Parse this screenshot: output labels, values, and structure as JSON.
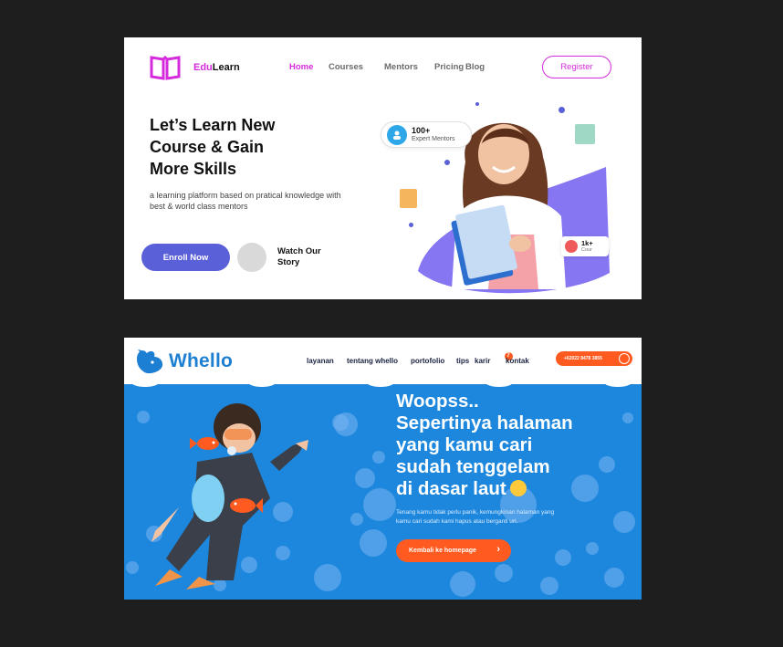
{
  "edulearn": {
    "brand": {
      "part1": "Edu",
      "part2": "Learn"
    },
    "nav": [
      "Home",
      "Courses",
      "Mentors",
      "Pricing",
      "Blog"
    ],
    "register_label": "Register",
    "headline": [
      "Let’s Learn New",
      "Course & Gain",
      "More Skills"
    ],
    "subtitle": [
      "a learning platform based on  pratical knowledge with",
      "best & world class mentors"
    ],
    "enroll_label": "Enroll Now",
    "watch_label": [
      "Watch Our",
      "Story"
    ],
    "mentors_badge": {
      "count": "100+",
      "label": "Expert Mentors"
    },
    "courses_badge": {
      "count": "1k+",
      "label": "Cour"
    },
    "colors": {
      "accent": "#d52bdc",
      "primary": "#5a60d8"
    }
  },
  "whello": {
    "brand": "Whello",
    "nav": [
      "layanan",
      "tentang whello",
      "portofolio",
      "tips",
      "karir",
      "kontak"
    ],
    "karir_badge": "7",
    "phone": "+62022 8478 3855",
    "headline": [
      "Woopss..",
      "Sepertinya halaman",
      "yang kamu cari",
      "sudah tenggelam",
      "di dasar laut"
    ],
    "subtitle": [
      "Tenang kamu tidak perlu panik, kemungkinan halaman yang",
      "kamu cari sudah kami hapus atau berganti url."
    ],
    "button_label": "Kembali ke homepage",
    "colors": {
      "background": "#1d87dd",
      "accent": "#ff5a1f"
    }
  }
}
